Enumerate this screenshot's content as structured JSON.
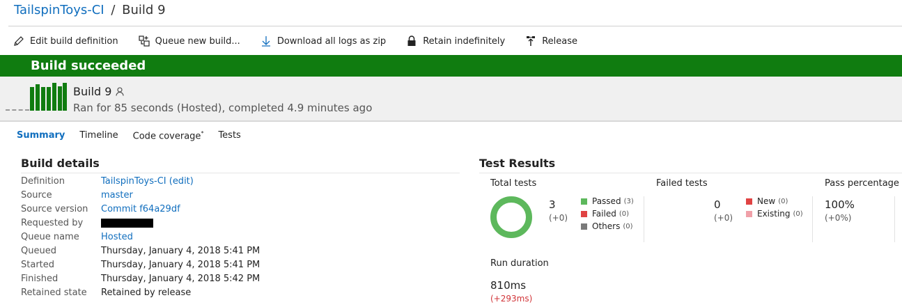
{
  "breadcrumb": {
    "pipeline": "TailspinToys-CI",
    "separator": "/",
    "build": "Build 9"
  },
  "toolbar": {
    "edit_label": "Edit build definition",
    "queue_label": "Queue new build...",
    "download_label": "Download all logs as zip",
    "retain_label": "Retain indefinitely",
    "release_label": "Release"
  },
  "banner": {
    "status_text": "Build succeeded",
    "color": "#107c10"
  },
  "build": {
    "name": "Build 9",
    "meta": "Ran for 85 seconds (Hosted), completed 4.9 minutes ago"
  },
  "tabs": [
    {
      "label": "Summary",
      "active": true
    },
    {
      "label": "Timeline"
    },
    {
      "label": "Code coverage",
      "suffix": "*"
    },
    {
      "label": "Tests"
    }
  ],
  "build_details": {
    "title": "Build details",
    "rows": [
      {
        "label": "Definition",
        "value": "TailspinToys-CI (edit)"
      },
      {
        "label": "Source",
        "value": "master"
      },
      {
        "label": "Source version",
        "value": "Commit f64a29df"
      },
      {
        "label": "Requested by",
        "value": ""
      },
      {
        "label": "Queue name",
        "value": "Hosted"
      },
      {
        "label": "Queued",
        "value": "Thursday, January 4, 2018 5:41 PM"
      },
      {
        "label": "Started",
        "value": "Thursday, January 4, 2018 5:41 PM"
      },
      {
        "label": "Finished",
        "value": "Thursday, January 4, 2018 5:42 PM"
      },
      {
        "label": "Retained state",
        "value": "Retained by release"
      }
    ]
  },
  "test_results": {
    "title": "Test Results",
    "total": {
      "label": "Total tests",
      "count": "3",
      "delta": "(+0)",
      "legend": [
        {
          "label": "Passed",
          "count": "(3)",
          "color": "#5db85c"
        },
        {
          "label": "Failed",
          "count": "(0)",
          "color": "#e04343"
        },
        {
          "label": "Others",
          "count": "(0)",
          "color": "#7a7a7a"
        }
      ]
    },
    "failed": {
      "label": "Failed tests",
      "count": "0",
      "delta": "(+0)",
      "legend": [
        {
          "label": "New",
          "count": "(0)",
          "color": "#e04343"
        },
        {
          "label": "Existing",
          "count": "(0)",
          "color": "#f0a0a8"
        }
      ]
    },
    "pass": {
      "label": "Pass percentage",
      "value": "100%",
      "delta": "(+0%)"
    },
    "duration": {
      "label": "Run duration",
      "value": "810ms",
      "delta": "(+293ms)"
    }
  }
}
